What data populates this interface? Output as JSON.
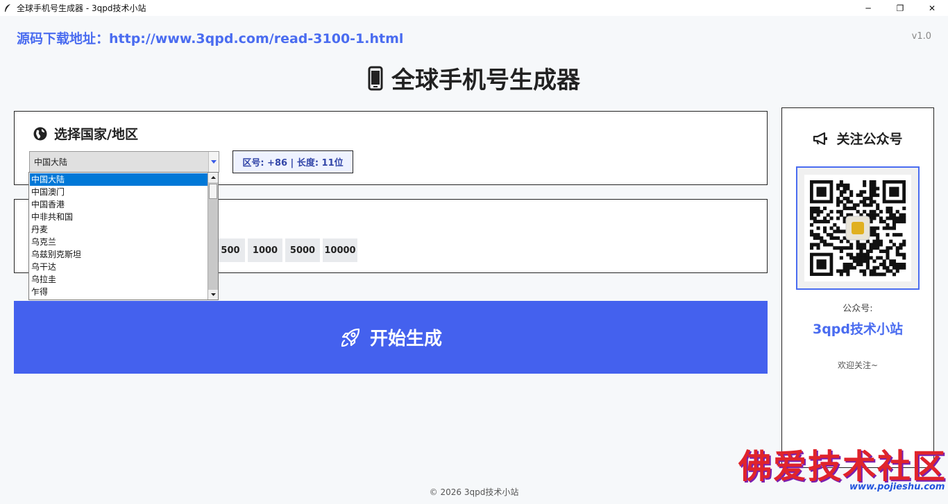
{
  "window": {
    "title": "全球手机号生成器 - 3qpd技术小站",
    "minimize": "─",
    "maximize": "❐",
    "close": "✕"
  },
  "header": {
    "source_link": "源码下载地址：http://www.3qpd.com/read-3100-1.html",
    "version": "v1.0",
    "main_title": "全球手机号生成器"
  },
  "country_section": {
    "heading": "选择国家/地区",
    "selected": "中国大陆",
    "info": "区号: +86 | 长度: 11位",
    "options": [
      "中国大陆",
      "中国澳门",
      "中国香港",
      "中非共和国",
      "丹麦",
      "乌克兰",
      "乌兹别克斯坦",
      "乌干达",
      "乌拉圭",
      "乍得"
    ]
  },
  "count_section": {
    "options_visible": [
      "500",
      "1000",
      "5000",
      "10000"
    ]
  },
  "generate": {
    "label": "开始生成"
  },
  "side_panel": {
    "heading": "关注公众号",
    "label": "公众号:",
    "name": "3qpd技术小站",
    "welcome": "欢迎关注~"
  },
  "footer": {
    "copyright": "© 2026 3qpd技术小站"
  },
  "watermark": {
    "text": "佛爱技术社区",
    "url": "www.pojieshu.com"
  },
  "colors": {
    "accent": "#4461ee",
    "link": "#4a6cf0",
    "selection": "#0078d7"
  }
}
